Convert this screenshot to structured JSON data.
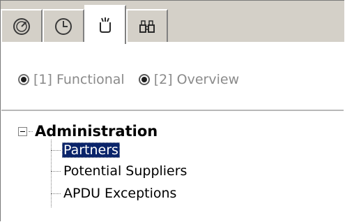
{
  "tabs": [
    {
      "icon": "clock-arrow-icon",
      "active": false
    },
    {
      "icon": "clock-icon",
      "active": false
    },
    {
      "icon": "cup-icon",
      "active": true
    },
    {
      "icon": "binoculars-icon",
      "active": false
    }
  ],
  "view_options": [
    {
      "label": "[1] Functional",
      "selected": true
    },
    {
      "label": "[2] Overview",
      "selected": false
    }
  ],
  "tree": {
    "root_label": "Administration",
    "expanded": true,
    "children": [
      {
        "label": "Partners",
        "selected": true
      },
      {
        "label": "Potential Suppliers",
        "selected": false
      },
      {
        "label": "APDU Exceptions",
        "selected": false
      }
    ]
  },
  "colors": {
    "tab_strip": "#d4d0c8",
    "selection_bg": "#0a246a",
    "selection_fg": "#ffffff",
    "radio_label": "#8a8a8a"
  }
}
